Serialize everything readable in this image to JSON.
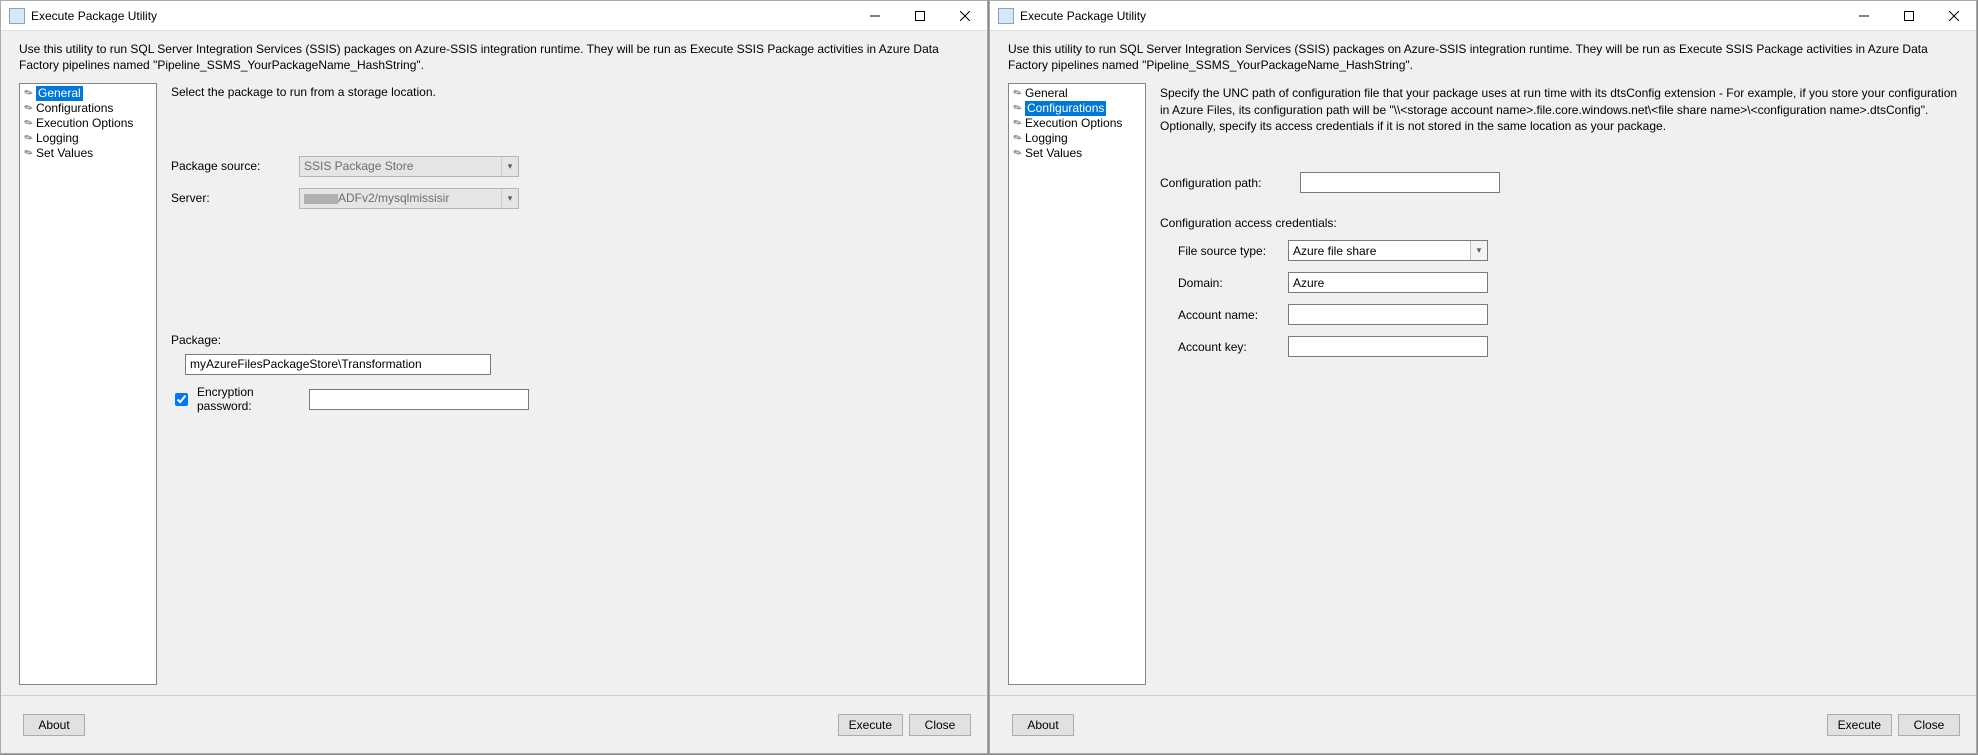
{
  "window_title": "Execute Package Utility",
  "description": "Use this utility to run SQL Server Integration Services (SSIS) packages on Azure-SSIS integration runtime. They will be run as Execute SSIS Package activities in Azure Data Factory pipelines named \"Pipeline_SSMS_YourPackageName_HashString\".",
  "sidebar": {
    "items": [
      {
        "label": "General"
      },
      {
        "label": "Configurations"
      },
      {
        "label": "Execution Options"
      },
      {
        "label": "Logging"
      },
      {
        "label": "Set Values"
      }
    ]
  },
  "left": {
    "selected_index": 0,
    "heading": "Select the package to run from a storage location.",
    "package_source_label": "Package source:",
    "package_source_value": "SSIS Package Store",
    "server_label": "Server:",
    "server_value": "ADFv2/mysqlmissisir",
    "package_label": "Package:",
    "package_value": "myAzureFilesPackageStore\\Transformation",
    "encpw_label": "Encryption password:",
    "encpw_checked": true
  },
  "right": {
    "selected_index": 1,
    "heading": "Specify the UNC path of configuration file that your package uses at run time with its dtsConfig extension - For example, if you store your configuration in Azure Files, its configuration path will be \"\\\\<storage account name>.file.core.windows.net\\<file share name>\\<configuration name>.dtsConfig\".  Optionally, specify its access credentials if it is not stored in the same location as your package.",
    "config_path_label": "Configuration path:",
    "config_path_value": "",
    "cred_heading": "Configuration access credentials:",
    "file_source_label": "File source type:",
    "file_source_value": "Azure file share",
    "domain_label": "Domain:",
    "domain_value": "Azure",
    "account_label": "Account name:",
    "account_value": "",
    "key_label": "Account key:",
    "key_value": ""
  },
  "footer": {
    "about": "About",
    "execute": "Execute",
    "close": "Close"
  }
}
